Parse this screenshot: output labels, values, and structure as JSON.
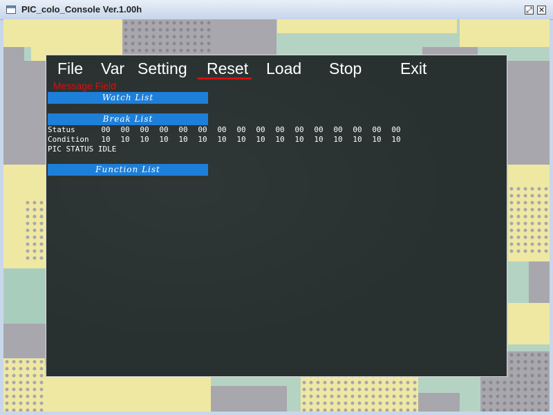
{
  "window": {
    "title": "PIC_colo_Console Ver.1.00h",
    "restore_icon": "restore-icon",
    "close_icon": "close-icon"
  },
  "menu": {
    "file": "File",
    "var": "Var",
    "setting": "Setting",
    "reset": "Reset",
    "load": "Load",
    "stop": "Stop",
    "exit": "Exit",
    "active": "Reset"
  },
  "message_field": "Message Field",
  "sections": {
    "watch_list": "Watch List",
    "break_list": "Break List",
    "function_list": "Function List"
  },
  "break_table": {
    "status_label": "Status",
    "condition_label": "Condition",
    "status_values": [
      "00",
      "00",
      "00",
      "00",
      "00",
      "00",
      "00",
      "00",
      "00",
      "00",
      "00",
      "00",
      "00",
      "00",
      "00",
      "00"
    ],
    "condition_values": [
      "10",
      "10",
      "10",
      "10",
      "10",
      "10",
      "10",
      "10",
      "10",
      "10",
      "10",
      "10",
      "10",
      "10",
      "10",
      "10"
    ],
    "pic_status": "PIC STATUS IDLE"
  },
  "colors": {
    "board": "#283130",
    "section_bar": "#1e7fd8",
    "accent_red": "#d41010"
  }
}
